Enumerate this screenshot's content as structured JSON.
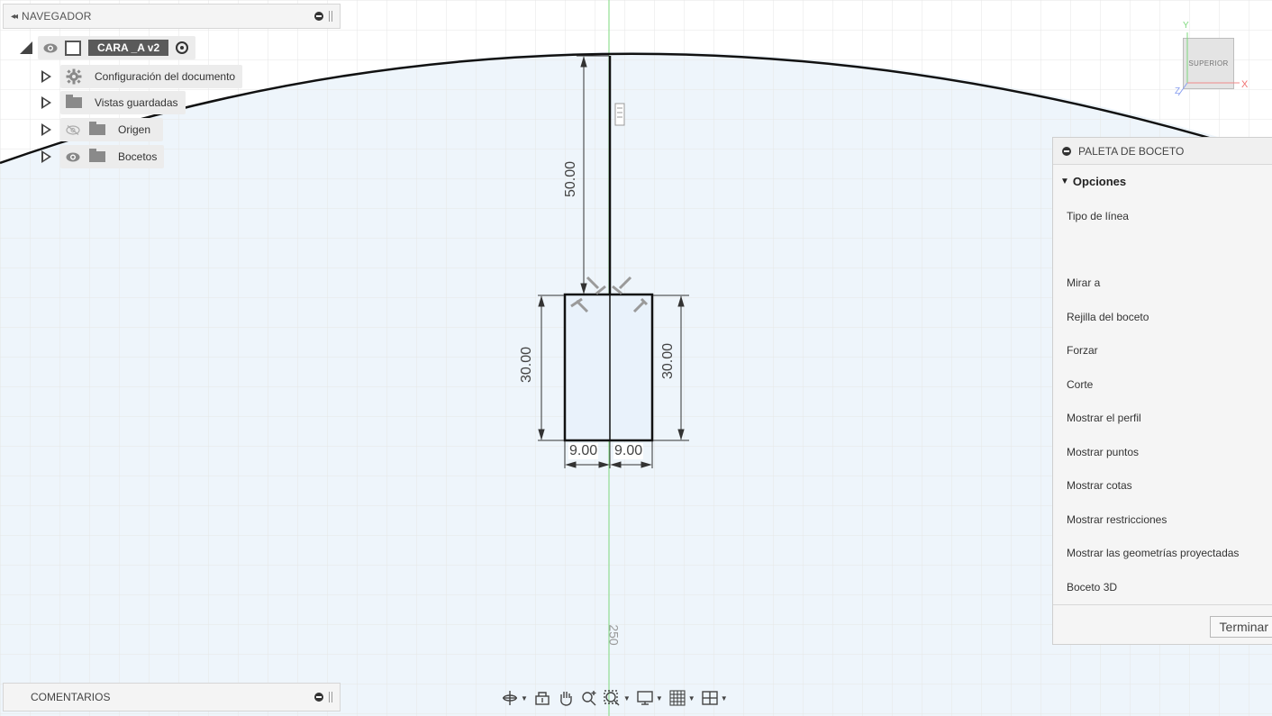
{
  "navigator": {
    "title": "NAVEGADOR",
    "component": "CARA _A v2",
    "items": [
      {
        "label": "Configuración del documento"
      },
      {
        "label": "Vistas guardadas"
      },
      {
        "label": "Origen"
      },
      {
        "label": "Bocetos"
      }
    ]
  },
  "comments": {
    "title": "COMENTARIOS"
  },
  "viewcube": {
    "face": "SUPERIOR",
    "axis_x": "X",
    "axis_y": "Y",
    "axis_z": "Z"
  },
  "sketch": {
    "dim_top": "50.00",
    "dim_left": "30.00",
    "dim_right": "30.00",
    "dim_bottom_left": "9.00",
    "dim_bottom_right": "9.00",
    "grid_label": "250"
  },
  "palette": {
    "title": "PALETA DE BOCETO",
    "section": "Opciones",
    "items": [
      "Tipo de línea",
      "Mirar a",
      "Rejilla del boceto",
      "Forzar",
      "Corte",
      "Mostrar el perfil",
      "Mostrar puntos",
      "Mostrar cotas",
      "Mostrar restricciones",
      "Mostrar las geometrías proyectadas",
      "Boceto 3D"
    ],
    "finish_button": "Terminar"
  },
  "toolbar": {
    "tools": [
      "orbit-icon",
      "look-at-icon",
      "pan-icon",
      "zoom-icon",
      "fit-icon",
      "display-icon",
      "grid-icon",
      "viewports-icon"
    ]
  },
  "colors": {
    "background": "#ffffff",
    "profile_fill": "#eef5fb",
    "grid": "#e6e6e6",
    "axis_green": "#7dd87d"
  }
}
